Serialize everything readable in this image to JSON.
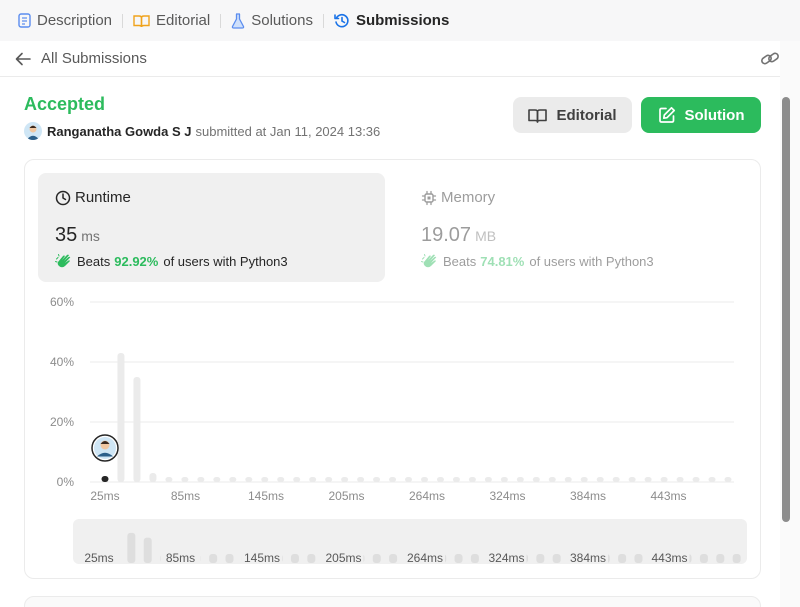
{
  "tabs": [
    {
      "label": "Description",
      "icon": "description-icon",
      "active": false
    },
    {
      "label": "Editorial",
      "icon": "book-icon",
      "active": false
    },
    {
      "label": "Solutions",
      "icon": "flask-icon",
      "active": false
    },
    {
      "label": "Submissions",
      "icon": "history-icon",
      "active": true
    }
  ],
  "subheader": {
    "back_label": "All Submissions"
  },
  "submission": {
    "status": "Accepted",
    "author": "Ranganatha Gowda S J",
    "submitted_text": "submitted at Jan 11, 2024 13:36"
  },
  "buttons": {
    "editorial": "Editorial",
    "solution": "Solution"
  },
  "runtime": {
    "title": "Runtime",
    "value": "35",
    "unit": "ms",
    "beats_label": "Beats",
    "beats_pct": "92.92%",
    "beats_suffix": "of users with Python3"
  },
  "memory": {
    "title": "Memory",
    "value": "19.07",
    "unit": "MB",
    "beats_label": "Beats",
    "beats_pct": "74.81%",
    "beats_suffix": "of users with Python3"
  },
  "colors": {
    "accent": "#2cbb5d",
    "bar": "#ebebeb",
    "marker": "#262626",
    "active_tab_icon": "#1a73e8"
  },
  "chart_data": {
    "type": "bar",
    "ylim": [
      0,
      60
    ],
    "yticks": [
      "0%",
      "20%",
      "40%",
      "60%"
    ],
    "xtick_labels": [
      "25ms",
      "85ms",
      "145ms",
      "205ms",
      "264ms",
      "324ms",
      "384ms",
      "443ms"
    ],
    "bin_count": 40,
    "values": [
      2,
      43,
      35,
      3,
      0.6,
      0.5,
      0.5,
      0.5,
      0.5,
      0.5,
      0.5,
      0.5,
      0.5,
      0.5,
      0.5,
      0.5,
      0.5,
      0.5,
      0.5,
      0.5,
      0.5,
      0.5,
      0.5,
      0.5,
      0.5,
      0.5,
      0.5,
      0.5,
      0.5,
      0.5,
      0.5,
      0.5,
      0.5,
      0.5,
      0.5,
      0.5,
      0.5,
      0.5,
      0.5,
      0.5
    ],
    "highlight_index": 0,
    "grid": true
  },
  "mini_chart": {
    "xtick_labels": [
      "25ms",
      "85ms",
      "145ms",
      "205ms",
      "264ms",
      "324ms",
      "384ms",
      "443ms"
    ]
  }
}
